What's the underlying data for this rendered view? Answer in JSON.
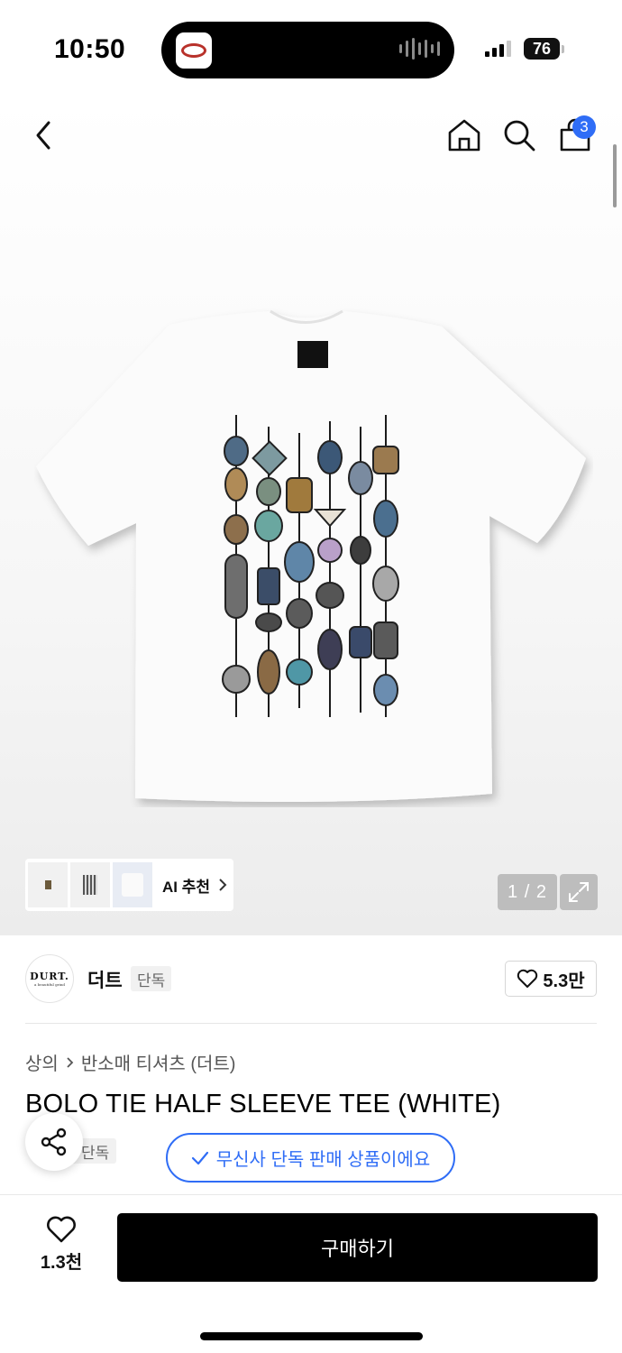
{
  "status": {
    "time": "10:50",
    "battery": "76"
  },
  "nav": {
    "cart_count": "3"
  },
  "gallery": {
    "ai_label": "AI 추천",
    "page_indicator": "1 / 2"
  },
  "brand": {
    "logo_text": "DURT.",
    "logo_tagline": "a beautiful grind",
    "name": "더트",
    "badge": "단독",
    "likes": "5.3만"
  },
  "breadcrumb": {
    "category": "상의",
    "subcategory": "반소매 티셔츠 (더트)"
  },
  "product": {
    "title": "BOLO TIE HALF SLEEVE TEE (WHITE)",
    "exclusive_chip": "단독",
    "musinsa_notice": "무신사 단독 판매 상품이에요"
  },
  "bottom": {
    "wish_count": "1.3천",
    "buy_label": "구매하기"
  },
  "colors": {
    "accent_blue": "#2f6df6",
    "buy_button": "#000000"
  },
  "icons": [
    "back-icon",
    "home-icon",
    "search-icon",
    "bag-icon",
    "chevron-right-icon",
    "expand-icon",
    "heart-icon",
    "share-icon",
    "check-icon"
  ]
}
